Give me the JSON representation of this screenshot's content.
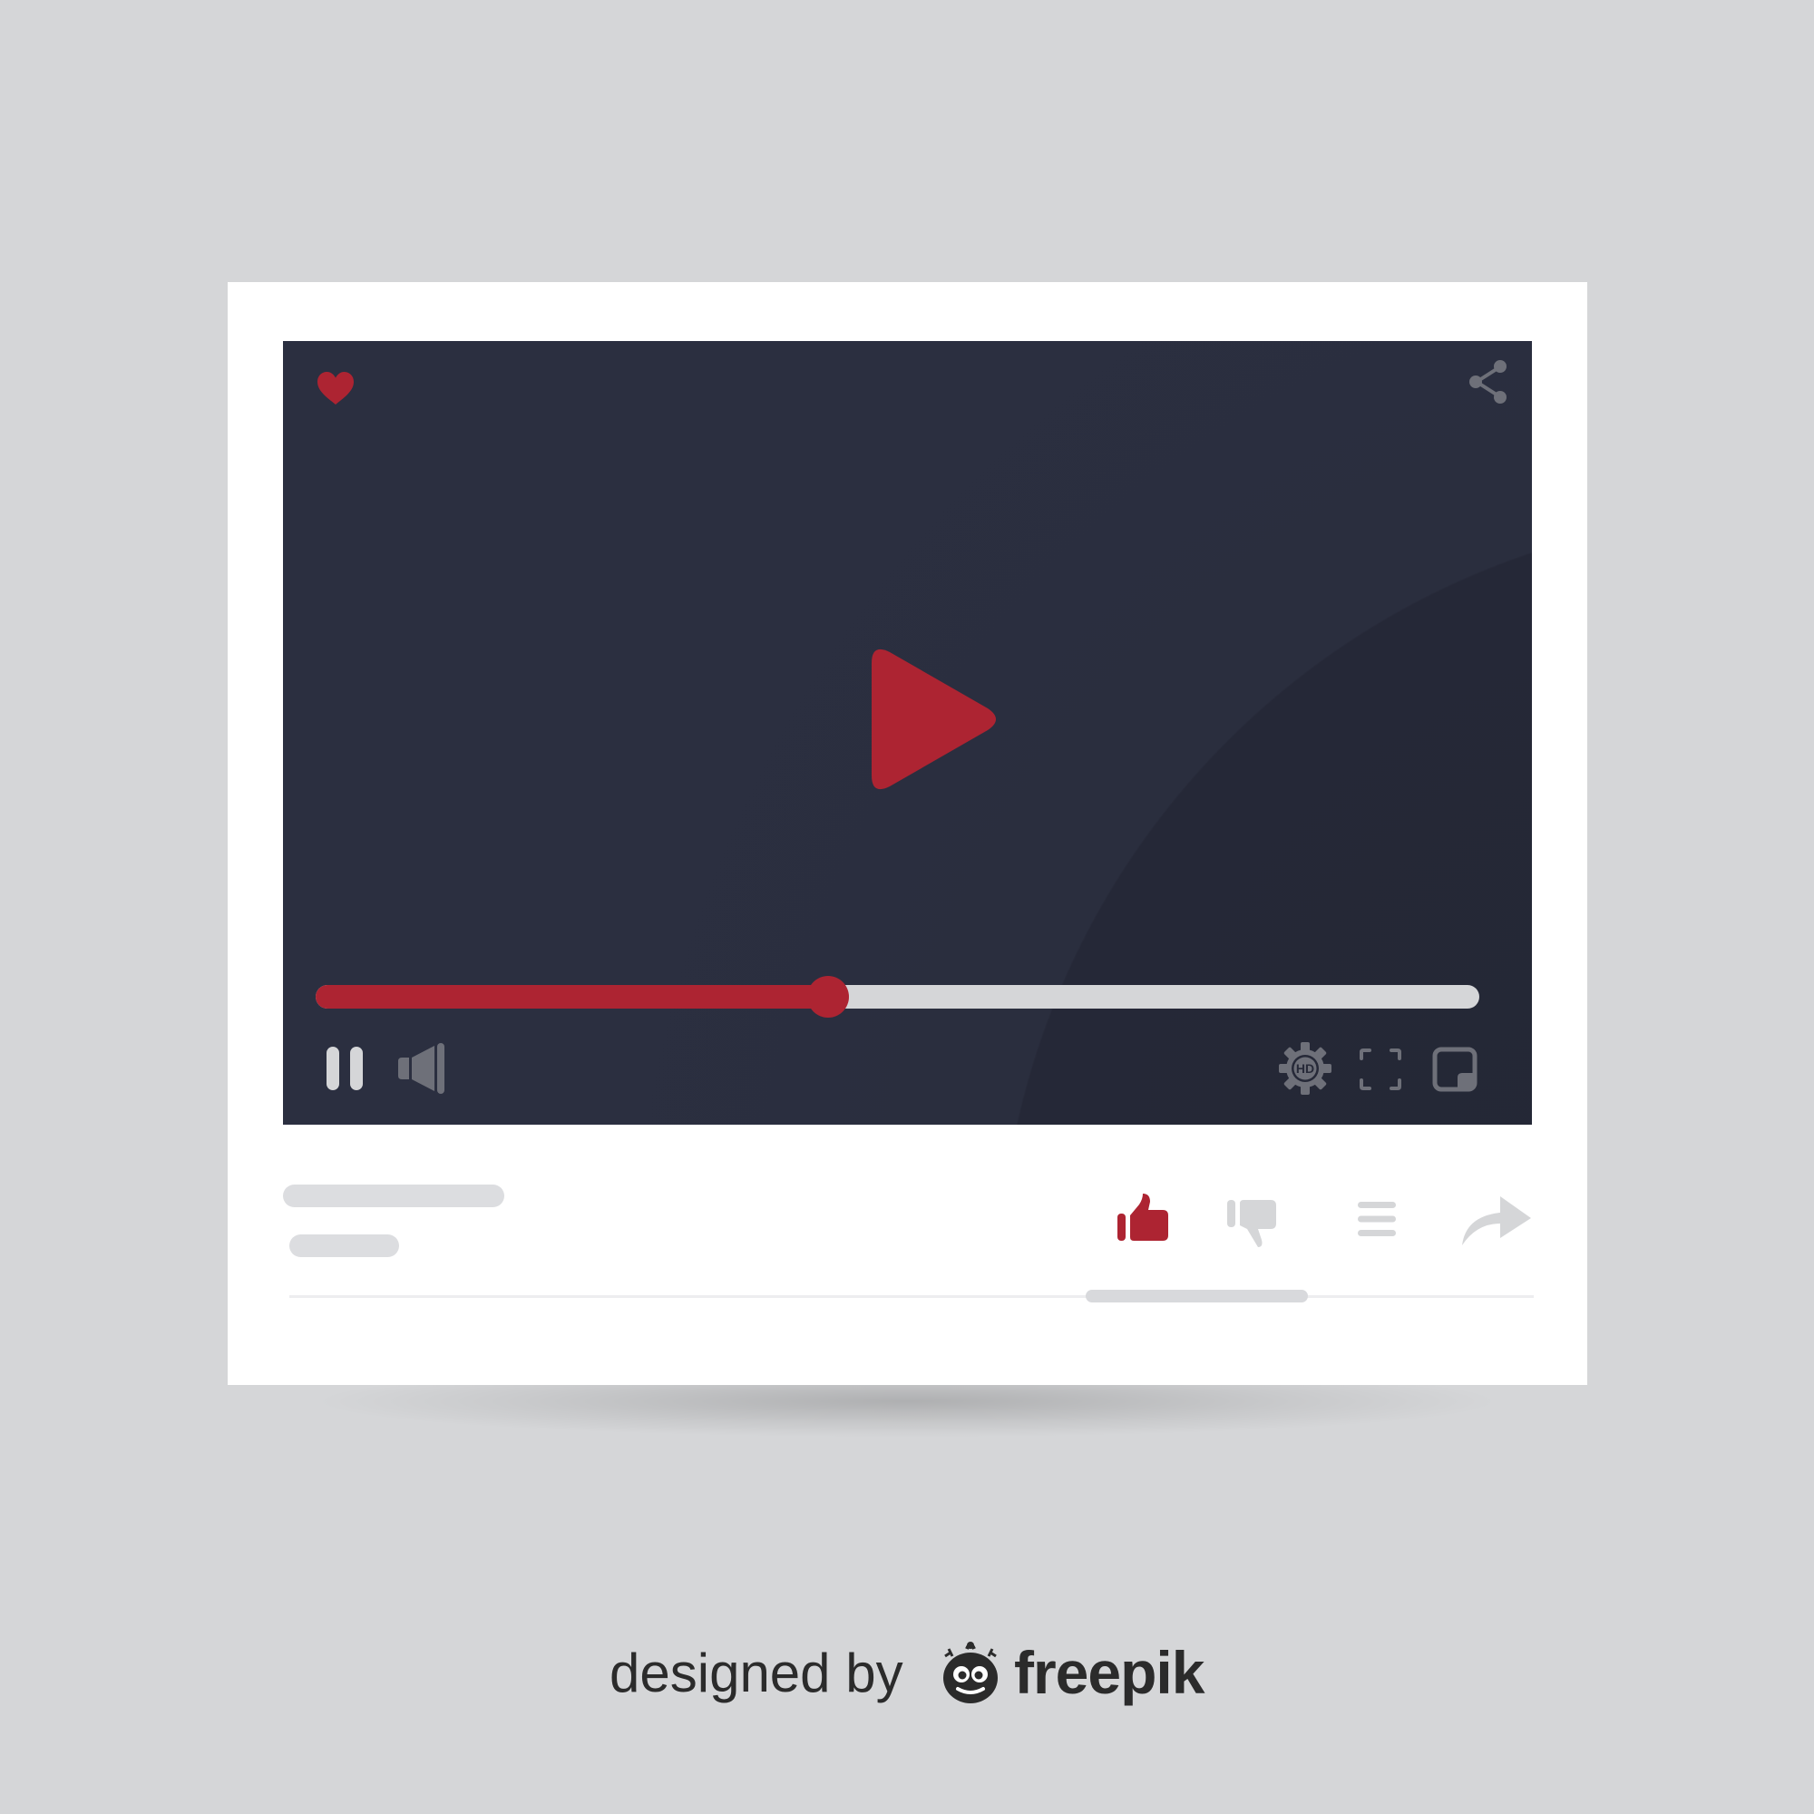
{
  "player": {
    "state": "paused-overlay",
    "progress_fraction": 0.44,
    "quality_badge": "HD"
  },
  "icons": {
    "favorite": "heart-icon",
    "share": "share-icon",
    "play": "play-icon",
    "pause": "pause-icon",
    "volume": "speaker-icon",
    "settings": "gear-icon",
    "fullscreen": "fullscreen-icon",
    "miniplayer": "miniplayer-icon",
    "like": "thumbs-up-icon",
    "dislike": "thumbs-down-icon",
    "playlist": "menu-icon",
    "forward": "forward-arrow-icon"
  },
  "colors": {
    "accent": "#ad2432",
    "screen_background": "#262938",
    "control_light": "#d5d6d8",
    "control_dim": "#6e7079",
    "page_background": "#d5d6d8",
    "card_background": "#ffffff",
    "placeholder": "#dcdde0"
  },
  "credit": {
    "prefix": "designed by",
    "brand": "freepik"
  }
}
